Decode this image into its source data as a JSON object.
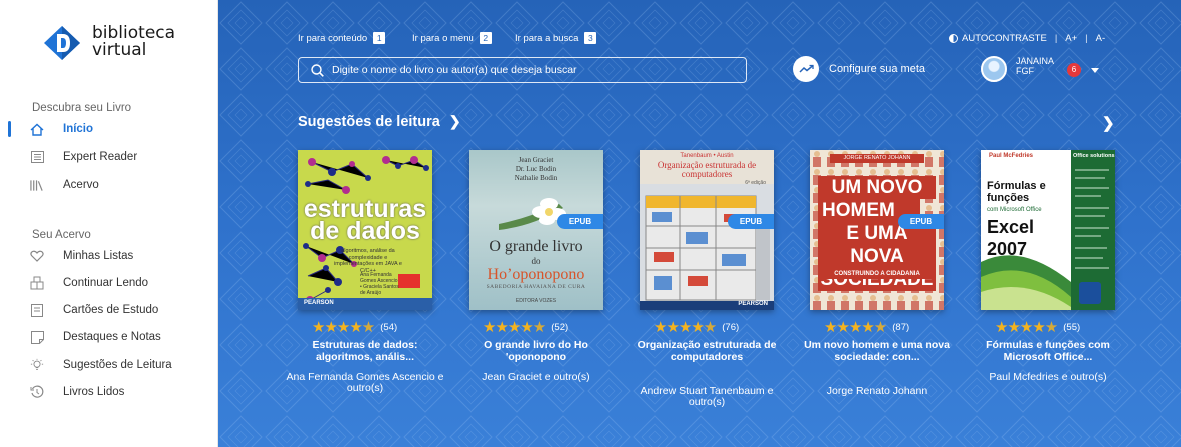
{
  "brand": {
    "line1": "biblioteca",
    "line2": "virtual"
  },
  "sidebar": {
    "discover_title": "Descubra seu Livro",
    "discover_items": [
      {
        "label": "Início",
        "icon": "home-icon",
        "active": true
      },
      {
        "label": "Expert Reader",
        "icon": "reader-icon"
      },
      {
        "label": "Acervo",
        "icon": "library-icon"
      }
    ],
    "collection_title": "Seu Acervo",
    "collection_items": [
      {
        "label": "Minhas Listas",
        "icon": "heart-icon"
      },
      {
        "label": "Continuar Lendo",
        "icon": "book-continue-icon"
      },
      {
        "label": "Cartões de Estudo",
        "icon": "cards-icon"
      },
      {
        "label": "Destaques e Notas",
        "icon": "notes-icon"
      },
      {
        "label": "Sugestões de Leitura",
        "icon": "lightbulb-icon"
      },
      {
        "label": "Livros Lidos",
        "icon": "history-icon"
      }
    ]
  },
  "skip_links": [
    {
      "label": "Ir para conteúdo",
      "key": "1"
    },
    {
      "label": "Ir para o menu",
      "key": "2"
    },
    {
      "label": "Ir para a busca",
      "key": "3"
    }
  ],
  "accessibility": {
    "contrast": "AUTOCONTRASTE",
    "font_up": "A+",
    "font_down": "A-"
  },
  "search": {
    "placeholder": "Digite o nome do livro ou autor(a) que deseja buscar"
  },
  "goal": {
    "label": "Configure sua meta"
  },
  "user": {
    "name": "JANAINA",
    "org": "FGF",
    "notifications": "6"
  },
  "suggestions": {
    "heading": "Sugestões de leitura",
    "books": [
      {
        "rating": "(54)",
        "stars": 4.5,
        "title": "Estruturas de dados: algoritmos, anális...",
        "author": "Ana Fernanda Gomes Ascencio e outro(s)",
        "epub": false,
        "cover": {
          "title": "estruturas de dados",
          "subtitle": "algoritmos, análise da complexidade e implementações em JAVA e C/C++",
          "authors": "Ana Fernanda Gomes Ascencio • Graciela Santos de Araújo",
          "publisher": "PEARSON"
        }
      },
      {
        "rating": "(52)",
        "stars": 4.5,
        "title": "O grande livro do Ho 'oponopono",
        "author": "Jean Graciet e outro(s)",
        "epub": true,
        "cover": {
          "authors": "Jean Graciet\nDr. Luc Bodin\nNathalie Bodin",
          "title1": "O grande livro",
          "title2": "do",
          "title3": "Ho’oponopono",
          "subtitle": "SABEDORIA HAVAIANA DE CURA",
          "publisher": "EDITORA VOZES"
        }
      },
      {
        "rating": "(76)",
        "stars": 4.5,
        "title": "Organização estruturada de computadores",
        "author": "Andrew Stuart Tanenbaum e outro(s)",
        "epub": true,
        "cover": {
          "authors": "Tanenbaum • Austin",
          "title": "Organização estruturada de computadores",
          "edition": "6ª edição",
          "publisher": "PEARSON"
        }
      },
      {
        "rating": "(87)",
        "stars": 4.5,
        "title": "Um novo homem e uma nova sociedade: con...",
        "author": "Jorge Renato Johann",
        "epub": true,
        "cover": {
          "author": "JORGE RENATO JOHANN",
          "line1": "UM NOVO",
          "line2": "HOMEM",
          "line3": "E UMA NOVA",
          "line4": "SOCIEDADE",
          "line5": "CONSTRUINDO A CIDADANIA"
        }
      },
      {
        "rating": "(55)",
        "stars": 4.5,
        "title": "Fórmulas e funções com Microsoft Office...",
        "author": "Paul Mcfedries e outro(s)",
        "epub": false,
        "cover": {
          "author": "Paul McFedries",
          "brand": "Office solutions",
          "title1": "Fórmulas e funções",
          "title2": "com Microsoft Office",
          "title3": "Excel 2007"
        }
      }
    ]
  },
  "colors": {
    "accent": "#1f73d6",
    "main_bg": "#2f72cc",
    "star": "#f3b320",
    "badge": "#e5383b"
  }
}
